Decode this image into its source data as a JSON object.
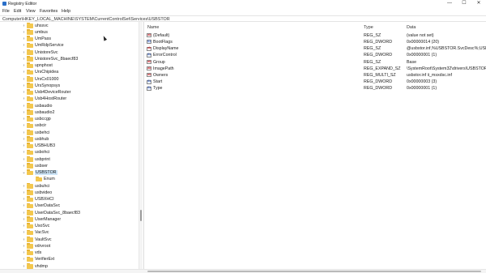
{
  "window": {
    "title": "Registry Editor",
    "min_icon": "—",
    "max_icon": "☐",
    "close_icon": "✕"
  },
  "menu": [
    "File",
    "Edit",
    "View",
    "Favorites",
    "Help"
  ],
  "address": "Computer\\HKEY_LOCAL_MACHINE\\SYSTEM\\CurrentControlSet\\Services\\USBSTOR",
  "tree": {
    "items": [
      {
        "label": "uhssvc",
        "expanded": false
      },
      {
        "label": "umbus",
        "expanded": false
      },
      {
        "label": "UmPass",
        "expanded": false
      },
      {
        "label": "UmRdpService",
        "expanded": false
      },
      {
        "label": "UnistoreSvc",
        "expanded": false
      },
      {
        "label": "UnistoreSvc_8baecf83",
        "expanded": false
      },
      {
        "label": "upnphost",
        "expanded": false
      },
      {
        "label": "UrsChipidea",
        "expanded": false
      },
      {
        "label": "UrsCx01000",
        "expanded": false
      },
      {
        "label": "UrsSynopsys",
        "expanded": false
      },
      {
        "label": "Usb4DeviceRouter",
        "expanded": false
      },
      {
        "label": "Usb4HostRouter",
        "expanded": false
      },
      {
        "label": "usbaudio",
        "expanded": false
      },
      {
        "label": "usbaudio2",
        "expanded": false
      },
      {
        "label": "usbccgp",
        "expanded": false
      },
      {
        "label": "usbcir",
        "expanded": false
      },
      {
        "label": "usbehci",
        "expanded": false
      },
      {
        "label": "usbhub",
        "expanded": false
      },
      {
        "label": "USBHUB3",
        "expanded": false
      },
      {
        "label": "usbohci",
        "expanded": false
      },
      {
        "label": "usbprint",
        "expanded": false
      },
      {
        "label": "usbser",
        "expanded": false
      },
      {
        "label": "USBSTOR",
        "expanded": true,
        "selected": true
      },
      {
        "label": "Enum",
        "child": true
      },
      {
        "label": "usbuhci",
        "expanded": false
      },
      {
        "label": "usbvideo",
        "expanded": false
      },
      {
        "label": "USBXHCI",
        "expanded": false
      },
      {
        "label": "UserDataSvc",
        "expanded": false
      },
      {
        "label": "UserDataSvc_8baecf83",
        "expanded": false
      },
      {
        "label": "UserManager",
        "expanded": false
      },
      {
        "label": "UsoSvc",
        "expanded": false
      },
      {
        "label": "VacSvc",
        "expanded": false
      },
      {
        "label": "VaultSvc",
        "expanded": false
      },
      {
        "label": "vdrvroot",
        "expanded": false
      },
      {
        "label": "vds",
        "expanded": false
      },
      {
        "label": "VerifierExt",
        "expanded": false
      },
      {
        "label": "vhdmp",
        "expanded": false
      },
      {
        "label": "vhdparser",
        "expanded": false
      }
    ]
  },
  "values": {
    "headers": {
      "name": "Name",
      "type": "Type",
      "data": "Data"
    },
    "rows": [
      {
        "icon": "string-value-icon",
        "name": "(Default)",
        "type": "REG_SZ",
        "data": "(value not set)"
      },
      {
        "icon": "binary-value-icon",
        "name": "BootFlags",
        "type": "REG_DWORD",
        "data": "0x00000014 (20)"
      },
      {
        "icon": "string-value-icon",
        "name": "DisplayName",
        "type": "REG_SZ",
        "data": "@usbstor.inf,%USBSTOR.SvcDesc%;USB M"
      },
      {
        "icon": "binary-value-icon",
        "name": "ErrorControl",
        "type": "REG_DWORD",
        "data": "0x00000001 (1)"
      },
      {
        "icon": "string-value-icon",
        "name": "Group",
        "type": "REG_SZ",
        "data": "Base"
      },
      {
        "icon": "string-value-icon",
        "name": "ImagePath",
        "type": "REG_EXPAND_SZ",
        "data": "\\SystemRoot\\System32\\drivers\\USBSTOR.SYS"
      },
      {
        "icon": "string-value-icon",
        "name": "Owners",
        "type": "REG_MULTI_SZ",
        "data": "usbstor.inf ii_msxdsc.inf"
      },
      {
        "icon": "binary-value-icon",
        "name": "Start",
        "type": "REG_DWORD",
        "data": "0x00000003 (3)"
      },
      {
        "icon": "binary-value-icon",
        "name": "Type",
        "type": "REG_DWORD",
        "data": "0x00000001 (1)"
      }
    ]
  }
}
